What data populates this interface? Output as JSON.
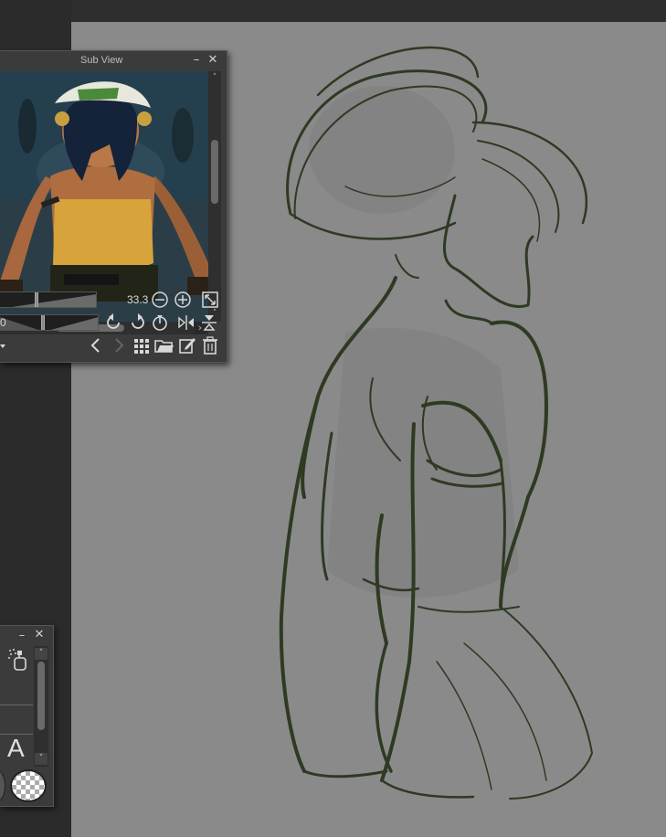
{
  "sub_view": {
    "title": "Sub View",
    "minimize": "–",
    "close": "✕",
    "zoom_value": "33.3",
    "rotate_value": "0",
    "scroll_right_arrow": "›",
    "scroll_up_arrow": "˄",
    "scroll_down_arrow": "˅"
  },
  "panel2": {
    "minimize": "–",
    "close": "✕",
    "text_tool_glyph": "A",
    "scroll_up_arrow": "˄",
    "scroll_down_arrow": "˅"
  },
  "colors": {
    "canvas": "#8a8a8a",
    "sketch_stroke": "#2e3a22",
    "panel_bg": "#3b3b3b"
  },
  "icons": [
    "zoom-out-icon",
    "zoom-in-icon",
    "fit-view-icon",
    "rotate-left-icon",
    "rotate-right-icon",
    "reset-rotation-icon",
    "flip-horizontal-icon",
    "flip-vertical-icon",
    "previous-icon",
    "next-icon",
    "grid-icon",
    "open-folder-icon",
    "edit-icon",
    "trash-icon",
    "airbrush-icon",
    "text-icon",
    "transparent-color-icon"
  ]
}
